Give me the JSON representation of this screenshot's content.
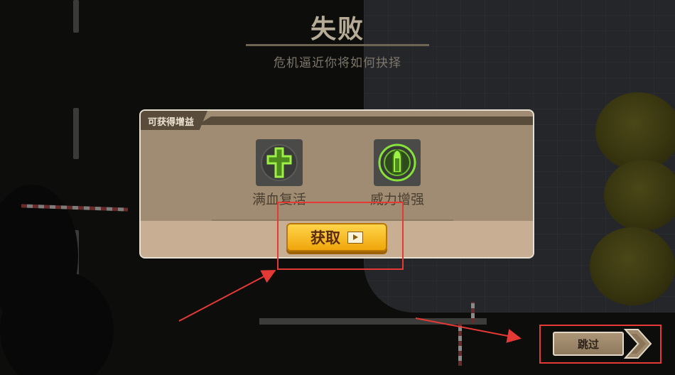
{
  "screen": {
    "title": "失败",
    "subtitle": "危机逼近你将如何抉择"
  },
  "reward_panel": {
    "header": "可获得增益",
    "buffs": [
      {
        "label": "满血复活",
        "icon": "cross-revive-icon"
      },
      {
        "label": "威力增强",
        "icon": "bullet-power-icon"
      }
    ],
    "get_button": {
      "label": "获取",
      "icon": "video-ad-icon"
    }
  },
  "skip_button": {
    "label": "跳过",
    "icon": "chevron-right-icon"
  },
  "colors": {
    "accent_green": "#86e33a",
    "button_gold": "#f5b922",
    "annotation_red": "#e53935",
    "panel_tan": "#a08c72"
  }
}
